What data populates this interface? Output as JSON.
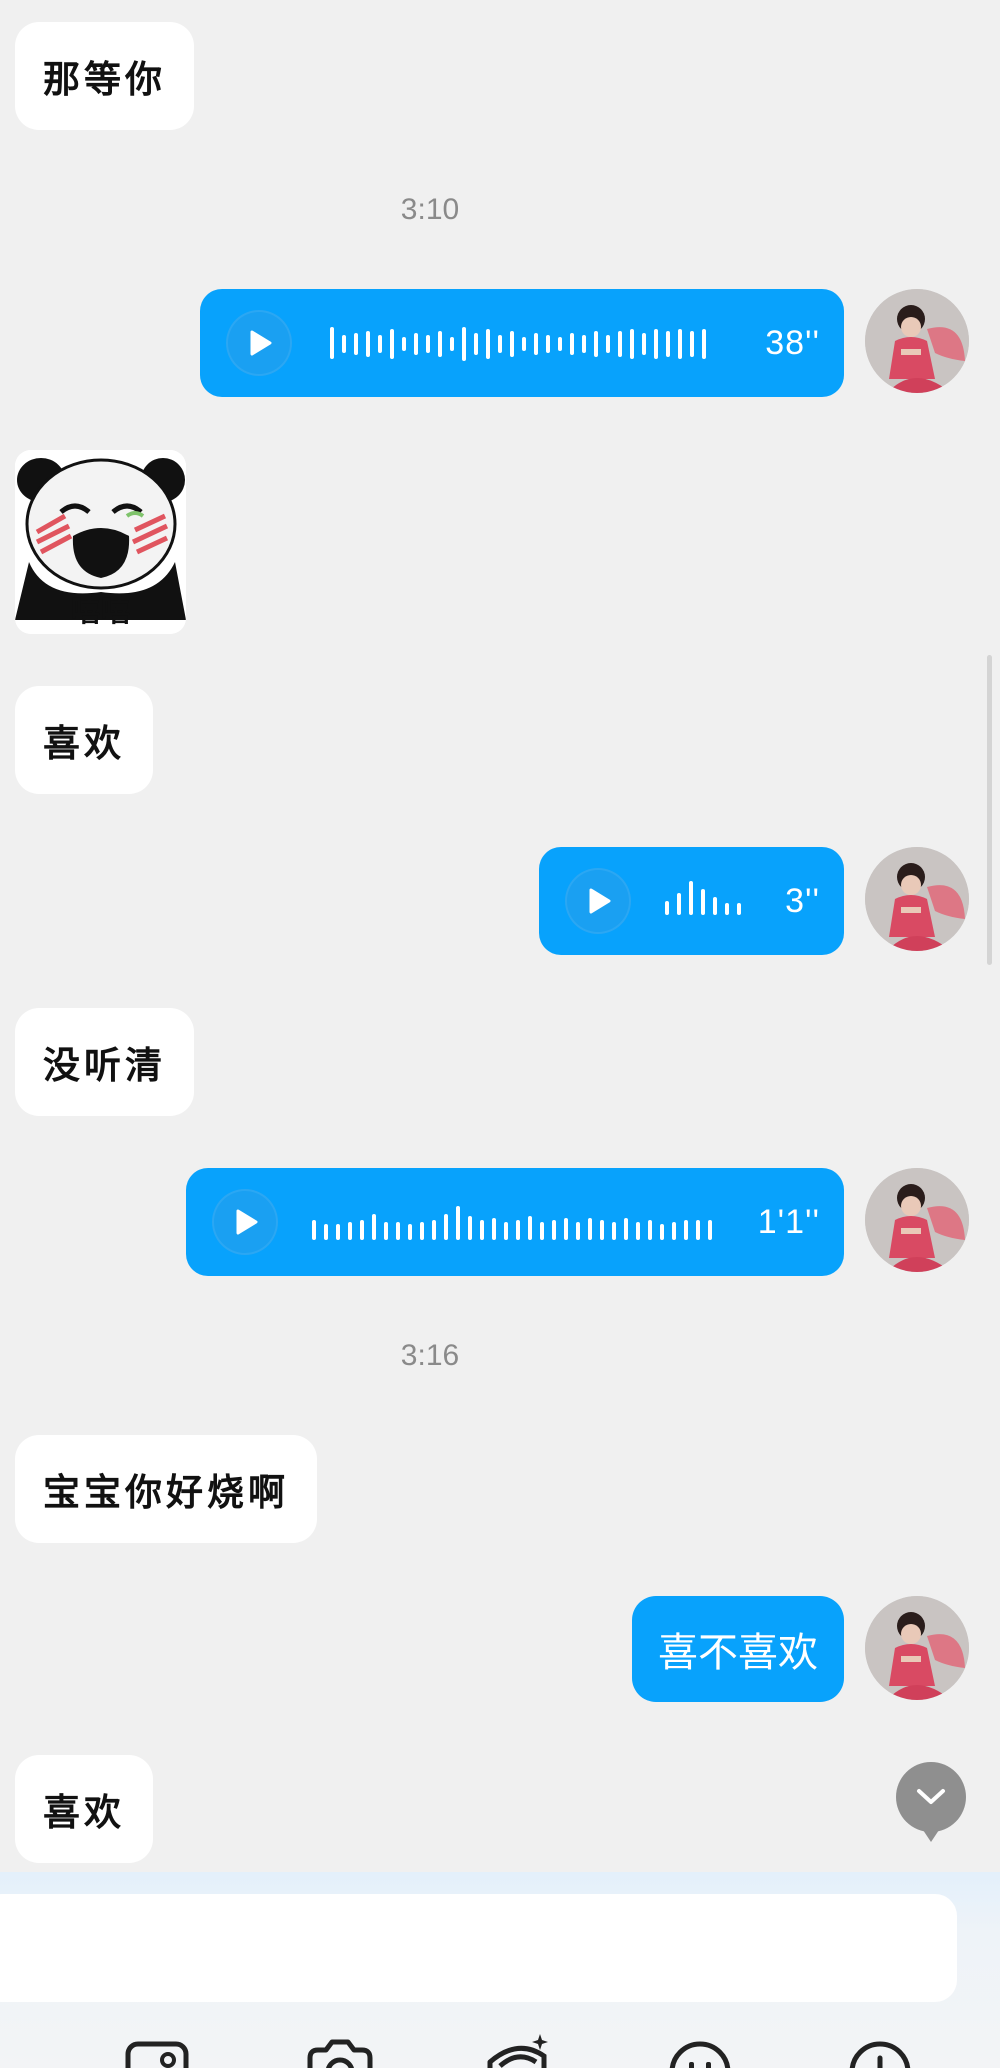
{
  "messages": {
    "m1_text": "那等你",
    "time1": "3:10",
    "voice1_duration": "38''",
    "sticker_caption": "嘻嘻",
    "m2_text": "喜欢",
    "voice2_duration": "3''",
    "m3_text": "没听清",
    "voice3_duration": "1'1''",
    "time2": "3:16",
    "m4_text": "宝宝你好烧啊",
    "out_text": "喜不喜欢",
    "m5_text": "喜欢"
  },
  "input": {
    "placeholder": ""
  },
  "toolbar": {
    "icons": [
      "image-icon",
      "camera-icon",
      "red-packet-icon",
      "emoji-icon",
      "plus-icon"
    ]
  },
  "colors": {
    "outgoing_bubble": "#08a2fc",
    "incoming_bubble": "#ffffff",
    "background": "#f0f0f0",
    "timestamp": "#8a8a8a"
  }
}
